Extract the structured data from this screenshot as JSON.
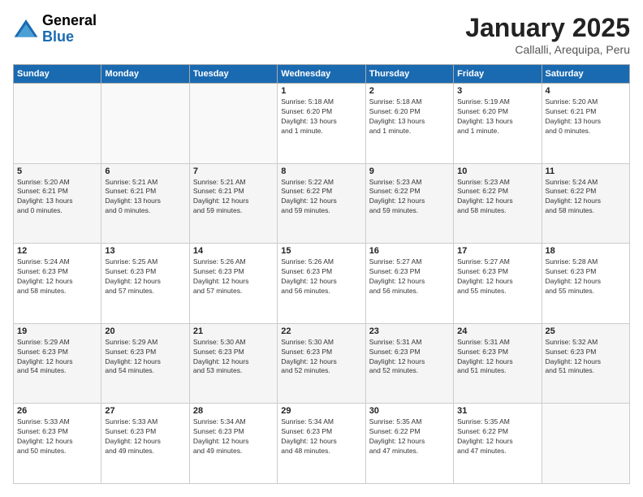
{
  "header": {
    "logo": {
      "general": "General",
      "blue": "Blue"
    },
    "title": "January 2025",
    "location": "Callalli, Arequipa, Peru"
  },
  "calendar": {
    "weekdays": [
      "Sunday",
      "Monday",
      "Tuesday",
      "Wednesday",
      "Thursday",
      "Friday",
      "Saturday"
    ],
    "weeks": [
      {
        "alt": false,
        "days": [
          {
            "num": "",
            "info": ""
          },
          {
            "num": "",
            "info": ""
          },
          {
            "num": "",
            "info": ""
          },
          {
            "num": "1",
            "info": "Sunrise: 5:18 AM\nSunset: 6:20 PM\nDaylight: 13 hours\nand 1 minute."
          },
          {
            "num": "2",
            "info": "Sunrise: 5:18 AM\nSunset: 6:20 PM\nDaylight: 13 hours\nand 1 minute."
          },
          {
            "num": "3",
            "info": "Sunrise: 5:19 AM\nSunset: 6:20 PM\nDaylight: 13 hours\nand 1 minute."
          },
          {
            "num": "4",
            "info": "Sunrise: 5:20 AM\nSunset: 6:21 PM\nDaylight: 13 hours\nand 0 minutes."
          }
        ]
      },
      {
        "alt": true,
        "days": [
          {
            "num": "5",
            "info": "Sunrise: 5:20 AM\nSunset: 6:21 PM\nDaylight: 13 hours\nand 0 minutes."
          },
          {
            "num": "6",
            "info": "Sunrise: 5:21 AM\nSunset: 6:21 PM\nDaylight: 13 hours\nand 0 minutes."
          },
          {
            "num": "7",
            "info": "Sunrise: 5:21 AM\nSunset: 6:21 PM\nDaylight: 12 hours\nand 59 minutes."
          },
          {
            "num": "8",
            "info": "Sunrise: 5:22 AM\nSunset: 6:22 PM\nDaylight: 12 hours\nand 59 minutes."
          },
          {
            "num": "9",
            "info": "Sunrise: 5:23 AM\nSunset: 6:22 PM\nDaylight: 12 hours\nand 59 minutes."
          },
          {
            "num": "10",
            "info": "Sunrise: 5:23 AM\nSunset: 6:22 PM\nDaylight: 12 hours\nand 58 minutes."
          },
          {
            "num": "11",
            "info": "Sunrise: 5:24 AM\nSunset: 6:22 PM\nDaylight: 12 hours\nand 58 minutes."
          }
        ]
      },
      {
        "alt": false,
        "days": [
          {
            "num": "12",
            "info": "Sunrise: 5:24 AM\nSunset: 6:23 PM\nDaylight: 12 hours\nand 58 minutes."
          },
          {
            "num": "13",
            "info": "Sunrise: 5:25 AM\nSunset: 6:23 PM\nDaylight: 12 hours\nand 57 minutes."
          },
          {
            "num": "14",
            "info": "Sunrise: 5:26 AM\nSunset: 6:23 PM\nDaylight: 12 hours\nand 57 minutes."
          },
          {
            "num": "15",
            "info": "Sunrise: 5:26 AM\nSunset: 6:23 PM\nDaylight: 12 hours\nand 56 minutes."
          },
          {
            "num": "16",
            "info": "Sunrise: 5:27 AM\nSunset: 6:23 PM\nDaylight: 12 hours\nand 56 minutes."
          },
          {
            "num": "17",
            "info": "Sunrise: 5:27 AM\nSunset: 6:23 PM\nDaylight: 12 hours\nand 55 minutes."
          },
          {
            "num": "18",
            "info": "Sunrise: 5:28 AM\nSunset: 6:23 PM\nDaylight: 12 hours\nand 55 minutes."
          }
        ]
      },
      {
        "alt": true,
        "days": [
          {
            "num": "19",
            "info": "Sunrise: 5:29 AM\nSunset: 6:23 PM\nDaylight: 12 hours\nand 54 minutes."
          },
          {
            "num": "20",
            "info": "Sunrise: 5:29 AM\nSunset: 6:23 PM\nDaylight: 12 hours\nand 54 minutes."
          },
          {
            "num": "21",
            "info": "Sunrise: 5:30 AM\nSunset: 6:23 PM\nDaylight: 12 hours\nand 53 minutes."
          },
          {
            "num": "22",
            "info": "Sunrise: 5:30 AM\nSunset: 6:23 PM\nDaylight: 12 hours\nand 52 minutes."
          },
          {
            "num": "23",
            "info": "Sunrise: 5:31 AM\nSunset: 6:23 PM\nDaylight: 12 hours\nand 52 minutes."
          },
          {
            "num": "24",
            "info": "Sunrise: 5:31 AM\nSunset: 6:23 PM\nDaylight: 12 hours\nand 51 minutes."
          },
          {
            "num": "25",
            "info": "Sunrise: 5:32 AM\nSunset: 6:23 PM\nDaylight: 12 hours\nand 51 minutes."
          }
        ]
      },
      {
        "alt": false,
        "days": [
          {
            "num": "26",
            "info": "Sunrise: 5:33 AM\nSunset: 6:23 PM\nDaylight: 12 hours\nand 50 minutes."
          },
          {
            "num": "27",
            "info": "Sunrise: 5:33 AM\nSunset: 6:23 PM\nDaylight: 12 hours\nand 49 minutes."
          },
          {
            "num": "28",
            "info": "Sunrise: 5:34 AM\nSunset: 6:23 PM\nDaylight: 12 hours\nand 49 minutes."
          },
          {
            "num": "29",
            "info": "Sunrise: 5:34 AM\nSunset: 6:23 PM\nDaylight: 12 hours\nand 48 minutes."
          },
          {
            "num": "30",
            "info": "Sunrise: 5:35 AM\nSunset: 6:22 PM\nDaylight: 12 hours\nand 47 minutes."
          },
          {
            "num": "31",
            "info": "Sunrise: 5:35 AM\nSunset: 6:22 PM\nDaylight: 12 hours\nand 47 minutes."
          },
          {
            "num": "",
            "info": ""
          }
        ]
      }
    ]
  }
}
